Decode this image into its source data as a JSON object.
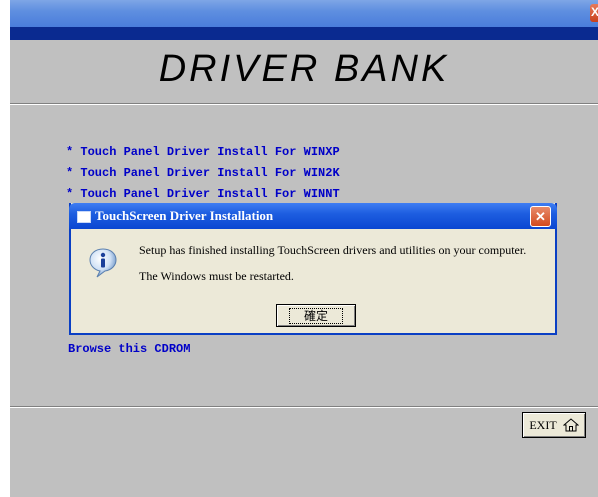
{
  "window": {
    "close_glyph": "X"
  },
  "app": {
    "title": "DRIVER BANK",
    "links": [
      "* Touch Panel Driver Install For WINXP",
      "* Touch Panel Driver Install For WIN2K",
      "* Touch Panel Driver Install For WINNT"
    ],
    "browse_label": "Browse this CDROM",
    "exit_label": "EXIT"
  },
  "dialog": {
    "title": "TouchScreen Driver Installation",
    "message_line1": "Setup has finished installing TouchScreen drivers and utilities on your computer.",
    "message_line2": "The Windows must be restarted.",
    "ok_label": "確定",
    "close_glyph": "✕"
  },
  "colors": {
    "link": "#0000c8",
    "title_bar": "#0a46d2",
    "background": "#c0c0c0",
    "dialog_bg": "#ece9d8"
  },
  "icons": {
    "dialog_icon": "info-icon",
    "exit_icon": "home-icon"
  }
}
